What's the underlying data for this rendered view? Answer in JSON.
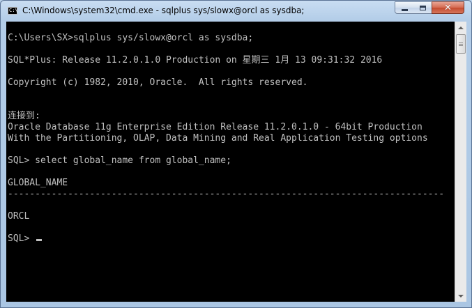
{
  "window": {
    "title": "C:\\Windows\\system32\\cmd.exe - sqlplus  sys/slowx@orcl as sysdba;",
    "icon_label": "C:\\",
    "controls": {
      "minimize": "minimize-icon",
      "maximize": "maximize-icon",
      "close": "✕"
    }
  },
  "console": {
    "lines": [
      "C:\\Users\\SX>sqlplus sys/slowx@orcl as sysdba;",
      "SQL*Plus: Release 11.2.0.1.0 Production on 星期三 1月 13 09:31:32 2016",
      "Copyright (c) 1982, 2010, Oracle.  All rights reserved.",
      "连接到:",
      "Oracle Database 11g Enterprise Edition Release 11.2.0.1.0 - 64bit Production",
      "With the Partitioning, OLAP, Data Mining and Real Application Testing options",
      "SQL> select global_name from global_name;",
      "GLOBAL_NAME",
      "--------------------------------------------------------------------------------",
      "ORCL",
      "SQL> "
    ]
  },
  "colors": {
    "console_bg": "#000000",
    "console_fg": "#c0c0c0",
    "title_bar": "#b9d1ea",
    "close_button": "#c94a2f"
  }
}
